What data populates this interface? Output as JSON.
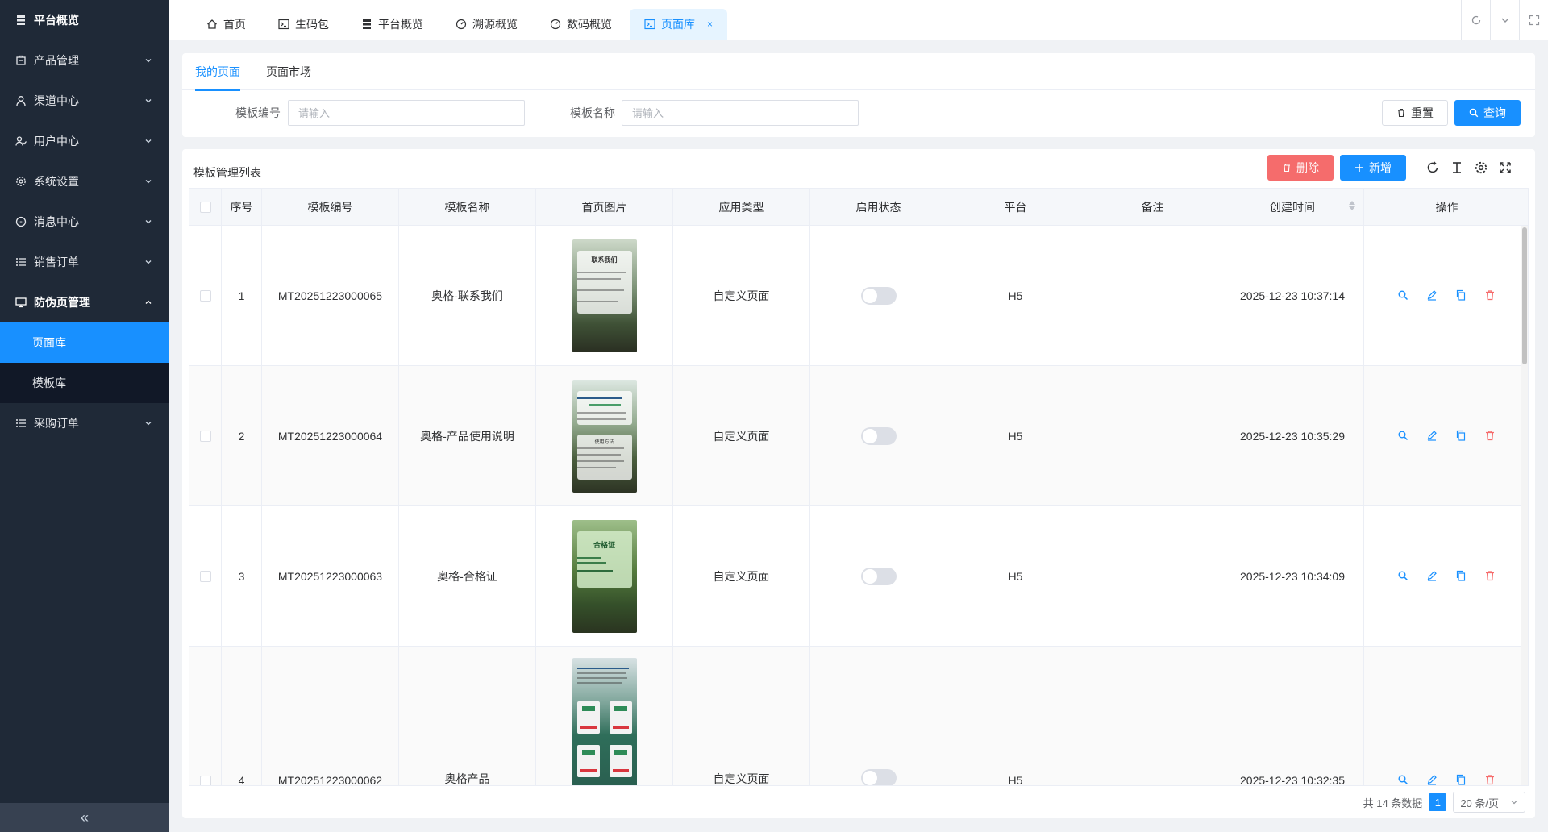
{
  "sidebar": {
    "items": [
      {
        "label": "平台概览",
        "icon": "server-icon",
        "has_children": false
      },
      {
        "label": "产品管理",
        "icon": "box-icon",
        "has_children": true
      },
      {
        "label": "渠道中心",
        "icon": "user-icon",
        "has_children": true
      },
      {
        "label": "用户中心",
        "icon": "users-icon",
        "has_children": true
      },
      {
        "label": "系统设置",
        "icon": "gear-icon",
        "has_children": true
      },
      {
        "label": "消息中心",
        "icon": "message-icon",
        "has_children": true
      },
      {
        "label": "销售订单",
        "icon": "list-icon",
        "has_children": true
      },
      {
        "label": "防伪页管理",
        "icon": "monitor-icon",
        "has_children": true,
        "expanded": true,
        "children": [
          {
            "label": "页面库",
            "active": true
          },
          {
            "label": "模板库",
            "active": false
          }
        ]
      },
      {
        "label": "采购订单",
        "icon": "list-icon",
        "has_children": true
      }
    ],
    "collapse_glyph": "«"
  },
  "tabs": [
    {
      "label": "首页",
      "icon": "home-icon"
    },
    {
      "label": "生码包",
      "icon": "terminal-icon"
    },
    {
      "label": "平台概览",
      "icon": "server-icon"
    },
    {
      "label": "溯源概览",
      "icon": "dashboard-icon"
    },
    {
      "label": "数码概览",
      "icon": "dashboard-icon"
    },
    {
      "label": "页面库",
      "icon": "terminal-icon",
      "active": true,
      "close": "×"
    }
  ],
  "search": {
    "subtabs": [
      {
        "label": "我的页面",
        "active": true
      },
      {
        "label": "页面市场",
        "active": false
      }
    ],
    "fields": [
      {
        "label": "模板编号",
        "placeholder": "请输入",
        "value": ""
      },
      {
        "label": "模板名称",
        "placeholder": "请输入",
        "value": ""
      }
    ],
    "reset_label": "重置",
    "query_label": "查询"
  },
  "table_panel": {
    "title": "模板管理列表",
    "delete_label": "删除",
    "add_label": "新增",
    "columns": [
      "序号",
      "模板编号",
      "模板名称",
      "首页图片",
      "应用类型",
      "启用状态",
      "平台",
      "备注",
      "创建时间",
      "操作"
    ],
    "rows": [
      {
        "index": "1",
        "code": "MT20251223000065",
        "name": "奥格-联系我们",
        "app_type": "自定义页面",
        "enabled": false,
        "platform": "H5",
        "note": "",
        "created": "2025-12-23 10:37:14",
        "thumb_title": "联系我们"
      },
      {
        "index": "2",
        "code": "MT20251223000064",
        "name": "奥格-产品使用说明",
        "app_type": "自定义页面",
        "enabled": false,
        "platform": "H5",
        "note": "",
        "created": "2025-12-23 10:35:29",
        "thumb_title": "使用方法"
      },
      {
        "index": "3",
        "code": "MT20251223000063",
        "name": "奥格-合格证",
        "app_type": "自定义页面",
        "enabled": false,
        "platform": "H5",
        "note": "",
        "created": "2025-12-23 10:34:09",
        "thumb_title": "合格证"
      },
      {
        "index": "4",
        "code": "MT20251223000062",
        "name": "奥格产品",
        "app_type": "自定义页面",
        "enabled": false,
        "platform": "H5",
        "note": "",
        "created": "2025-12-23 10:32:35",
        "thumb_title": ""
      }
    ]
  },
  "pagination": {
    "total_text": "共 14 条数据",
    "current_page": "1",
    "page_size": "20 条/页"
  },
  "colors": {
    "primary": "#1890ff",
    "danger": "#f56c6c",
    "sidebar_bg": "#1f2937"
  }
}
